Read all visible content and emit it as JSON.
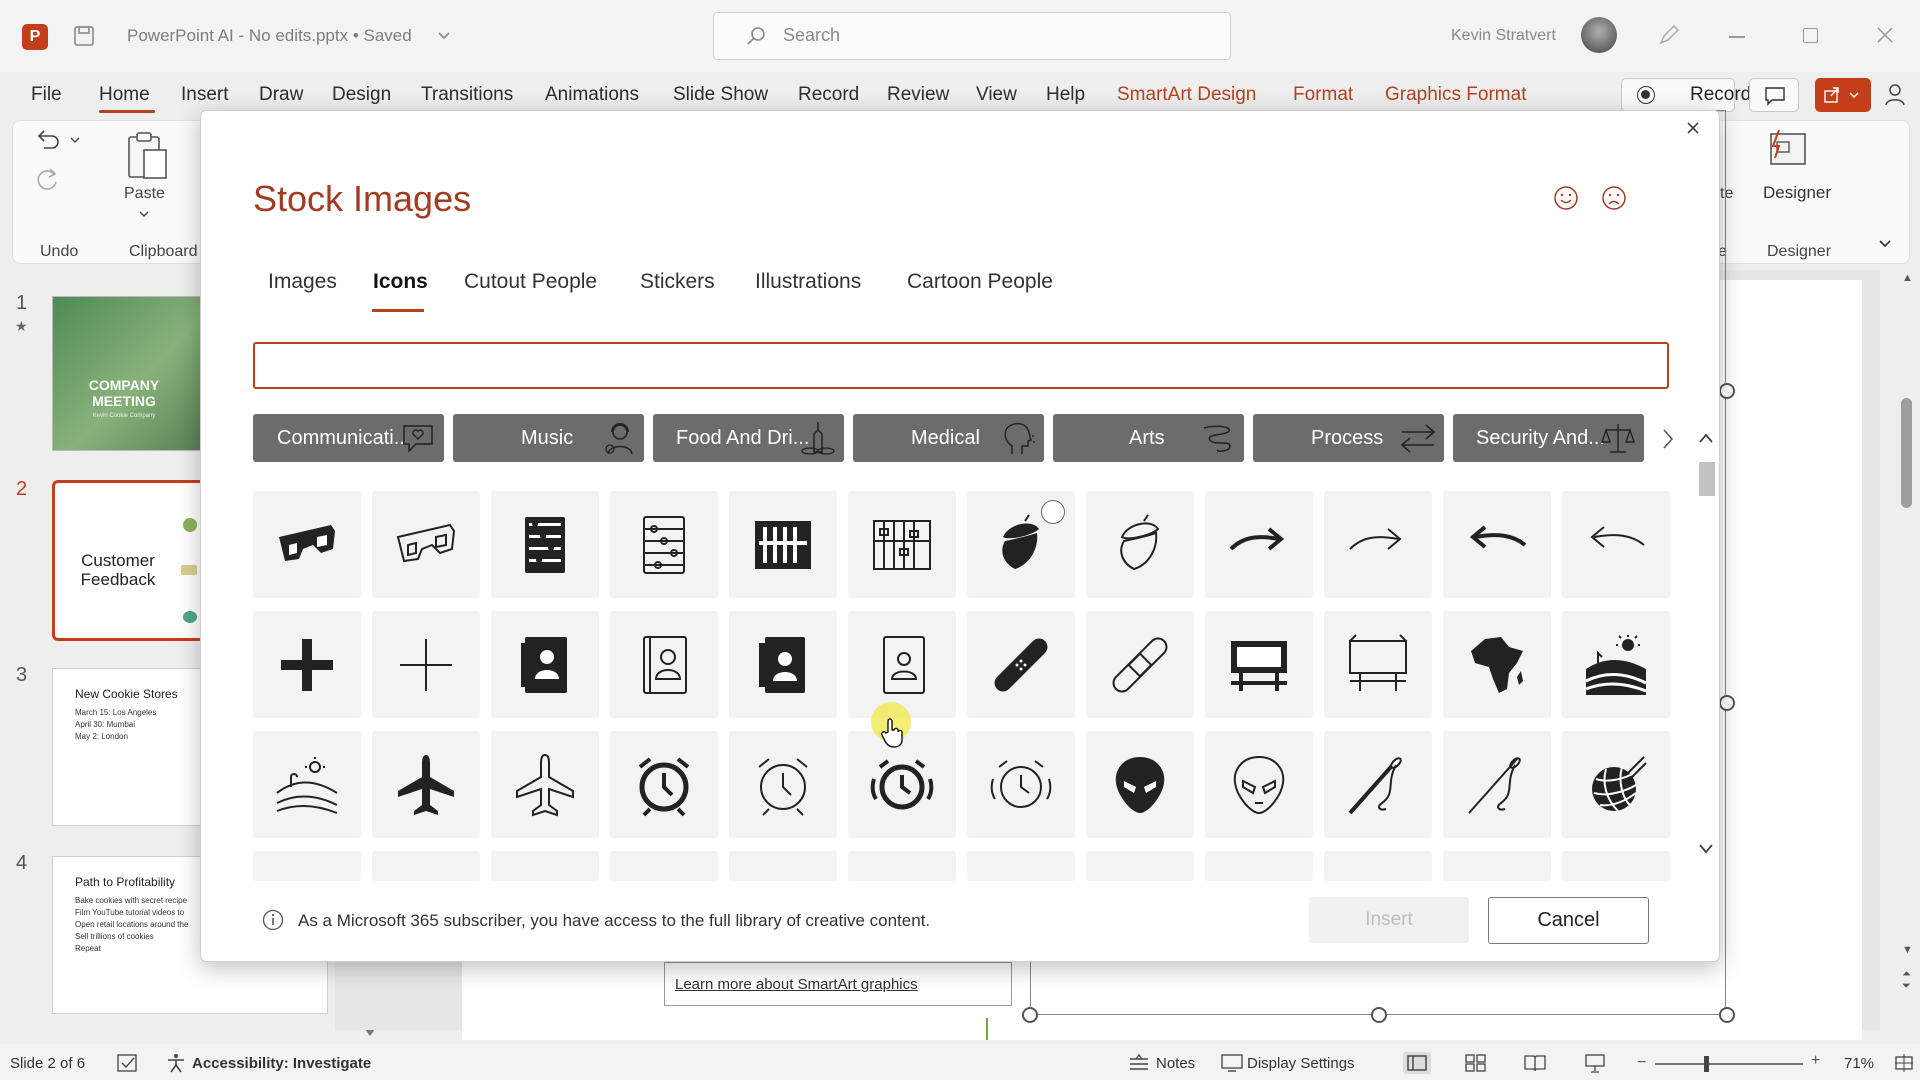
{
  "app": {
    "title": "PowerPoint AI - No edits.pptx • Saved",
    "search_placeholder": "Search",
    "user_name": "Kevin Stratvert"
  },
  "menu": {
    "items": [
      "File",
      "Home",
      "Insert",
      "Draw",
      "Design",
      "Transitions",
      "Animations",
      "Slide Show",
      "Record",
      "Review",
      "View",
      "Help"
    ],
    "context_items": [
      "SmartArt Design",
      "Format",
      "Graphics Format"
    ],
    "record_label": "Record"
  },
  "ribbon": {
    "undo_group": "Undo",
    "clipboard_group": "Clipboard",
    "paste_label": "Paste",
    "designer_label": "Designer",
    "designer_group": "Designer",
    "partial_text_1": "te",
    "partial_text_2": "e"
  },
  "slides": [
    {
      "number": "1",
      "title": "COMPANY MEETING",
      "subtitle": "Kevin Cookie Company"
    },
    {
      "number": "2",
      "title": "Customer Feedback"
    },
    {
      "number": "3",
      "title": "New Cookie Stores",
      "bullets": [
        "March 15: Los Angeles",
        "April 30: Mumbai",
        "May 2: London"
      ]
    },
    {
      "number": "4",
      "title": "Path to Profitability",
      "bullets": [
        "Bake cookies with secret recipe",
        "Film YouTube tutorial videos to",
        "Open retail locations around the",
        "Sell trillions of cookies",
        "Repeat"
      ]
    }
  ],
  "canvas": {
    "learn_more_link": "Learn more about SmartArt graphics"
  },
  "status": {
    "slide_info": "Slide 2 of 6",
    "accessibility": "Accessibility: Investigate",
    "notes": "Notes",
    "display_settings": "Display Settings",
    "zoom": "71%"
  },
  "dialog": {
    "title": "Stock Images",
    "tabs": [
      "Images",
      "Icons",
      "Cutout People",
      "Stickers",
      "Illustrations",
      "Cartoon People"
    ],
    "active_tab": "Icons",
    "search_value": "",
    "categories": [
      "Communicati...",
      "Music",
      "Food And Dri...",
      "Medical",
      "Arts",
      "Process",
      "Security And..."
    ],
    "icons": [
      [
        "3d-glasses",
        "3d-glasses-outline",
        "abacus",
        "abacus-outline",
        "abacus-square",
        "abacus-square-outline",
        "acorn",
        "acorn-outline",
        "arrow-right-curve",
        "arrow-right-curve-outline",
        "arrow-left-curve",
        "arrow-left-curve-outline"
      ],
      [
        "plus",
        "plus-outline",
        "address-book",
        "address-book-outline",
        "contact-card",
        "contact-card-outline",
        "bandage",
        "bandage-outline",
        "billboard",
        "billboard-outline",
        "africa",
        "farm-landscape"
      ],
      [
        "farm-landscape-outline",
        "airplane",
        "airplane-outline",
        "alarm-clock",
        "alarm-clock-outline",
        "alarm-ringing",
        "alarm-ringing-outline",
        "alien",
        "alien-outline",
        "needle",
        "needle-outline",
        "yarn-ball"
      ]
    ],
    "info_text": "As a Microsoft 365 subscriber, you have access to the full library of creative content.",
    "insert_label": "Insert",
    "cancel_label": "Cancel"
  }
}
